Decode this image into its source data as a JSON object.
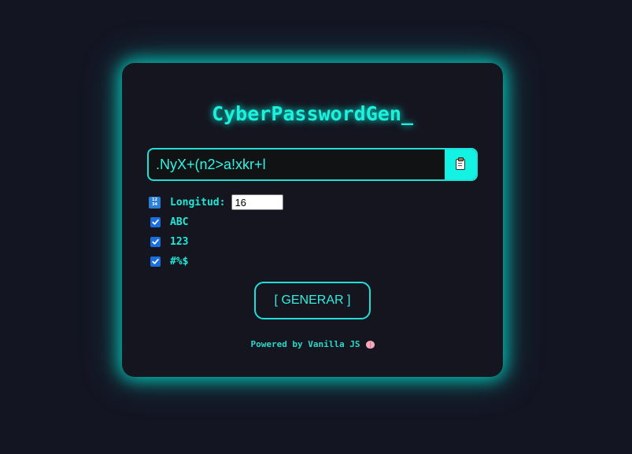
{
  "app": {
    "title": "CyberPasswordGen_"
  },
  "password": {
    "value": ".NyX+(n2>a!xkr+l",
    "copy_icon": "clipboard-icon"
  },
  "options": {
    "length_icon": "numbers-icon",
    "length_label": "Longitud:",
    "length_value": "16",
    "uppercase": {
      "label": "ABC",
      "checked": true
    },
    "numbers": {
      "label": "123",
      "checked": true
    },
    "symbols": {
      "label": "#%$",
      "checked": true
    }
  },
  "generate_button": {
    "label": "[ GENERAR ]"
  },
  "footer": {
    "text": "Powered by Vanilla JS",
    "icon": "brain-icon"
  },
  "colors": {
    "accent": "#1ee0d8",
    "background": "#141523",
    "card": "#151520",
    "checkbox": "#1a6ee0"
  }
}
